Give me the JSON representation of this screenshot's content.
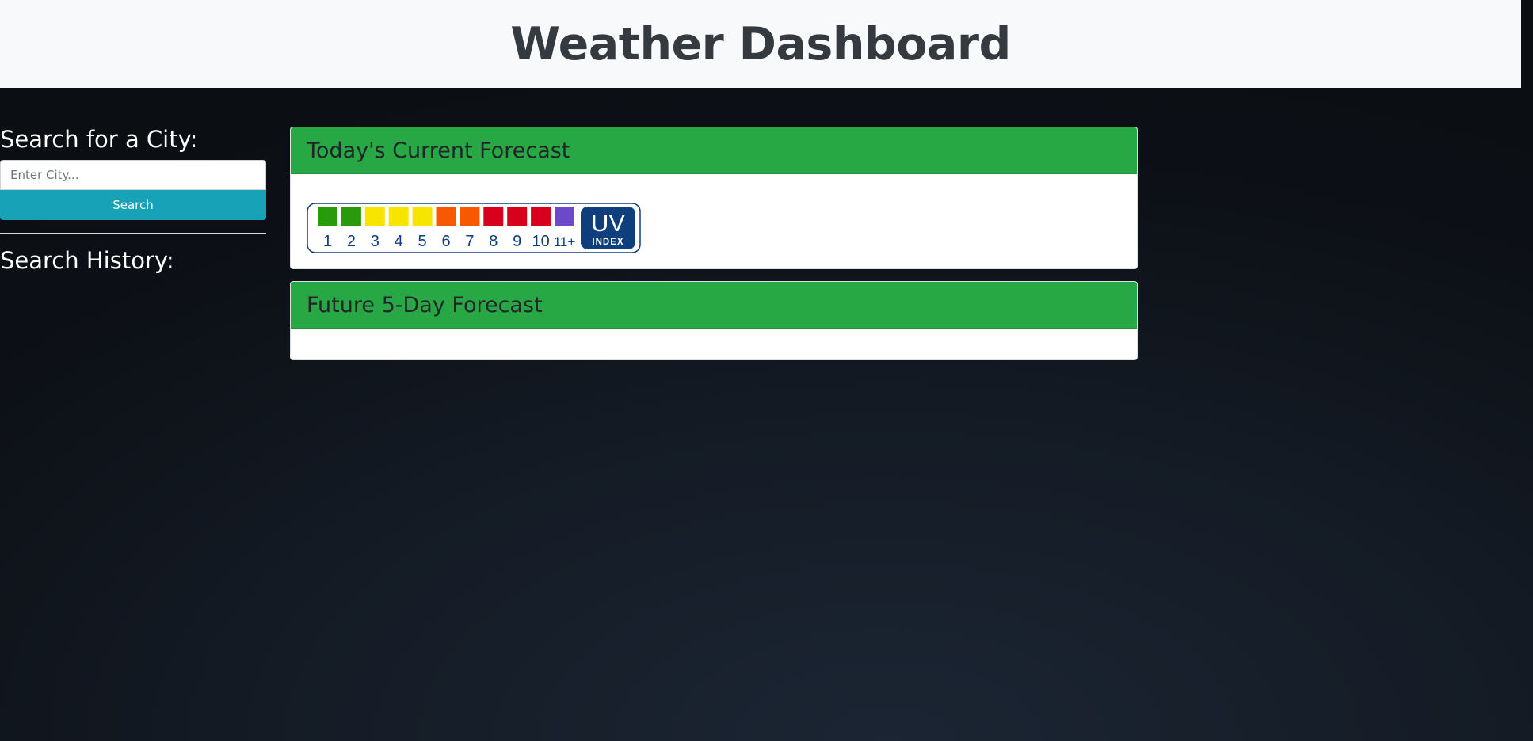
{
  "header": {
    "title": "Weather Dashboard"
  },
  "sidebar": {
    "search_heading": "Search for a City:",
    "search_placeholder": "Enter City...",
    "search_value": "",
    "search_button": "Search",
    "history_heading": "Search History:",
    "history_items": []
  },
  "today_card": {
    "title": "Today's Current Forecast",
    "uv_graphic": {
      "levels": [
        "1",
        "2",
        "3",
        "4",
        "5",
        "6",
        "7",
        "8",
        "9",
        "10",
        "11+"
      ],
      "level_colors": [
        "#299a0b",
        "#299a0b",
        "#f7e400",
        "#f7e400",
        "#f7e400",
        "#f85900",
        "#f85900",
        "#d8001d",
        "#d8001d",
        "#d8001d",
        "#6b49c8"
      ],
      "badge_text": "UV",
      "badge_subtext": "INDEX",
      "badge_color": "#0f3e7d"
    }
  },
  "future_card": {
    "title": "Future 5-Day Forecast",
    "days": []
  },
  "colors": {
    "header_bg": "#f8f9fa",
    "card_header_bg": "#28a745",
    "search_button_bg": "#17a2b8",
    "page_bg": "#0d1117"
  }
}
